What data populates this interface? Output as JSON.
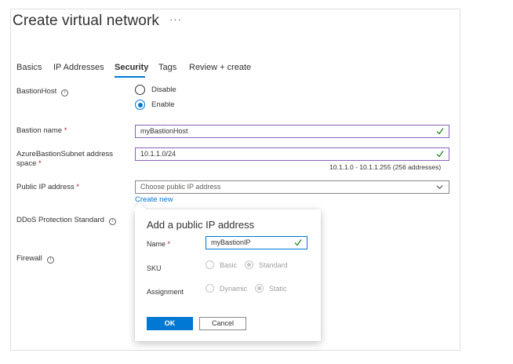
{
  "header": {
    "title": "Create virtual network",
    "more": "···"
  },
  "tabs": [
    {
      "label": "Basics"
    },
    {
      "label": "IP Addresses"
    },
    {
      "label": "Security"
    },
    {
      "label": "Tags"
    },
    {
      "label": "Review + create"
    }
  ],
  "form": {
    "bastion_host": {
      "label": "BastionHost",
      "options": [
        "Disable",
        "Enable"
      ],
      "selected": "Enable"
    },
    "bastion_name": {
      "label": "Bastion name",
      "required": "*",
      "value": "myBastionHost"
    },
    "subnet": {
      "label_line1": "AzureBastionSubnet address",
      "label_line2": "space",
      "required": "*",
      "value": "10.1.1.0/24",
      "hint": "10.1.1.0 - 10.1.1.255 (256 addresses)"
    },
    "public_ip": {
      "label": "Public IP address",
      "required": "*",
      "placeholder": "Choose public IP address",
      "create_link": "Create new"
    },
    "ddos": {
      "label": "DDoS Protection Standard"
    },
    "firewall": {
      "label": "Firewall"
    }
  },
  "dialog": {
    "title": "Add a public IP address",
    "name_label": "Name",
    "name_required": "*",
    "name_value": "myBastionIP",
    "sku_label": "SKU",
    "sku_options": [
      "Basic",
      "Standard"
    ],
    "sku_selected": "Standard",
    "assignment_label": "Assignment",
    "assignment_options": [
      "Dynamic",
      "Static"
    ],
    "assignment_selected": "Static",
    "ok_label": "OK",
    "cancel_label": "Cancel"
  },
  "colors": {
    "accent": "#0078d4",
    "valid_border": "#8764b8",
    "valid_check": "#107c10",
    "required": "#a4262c"
  }
}
